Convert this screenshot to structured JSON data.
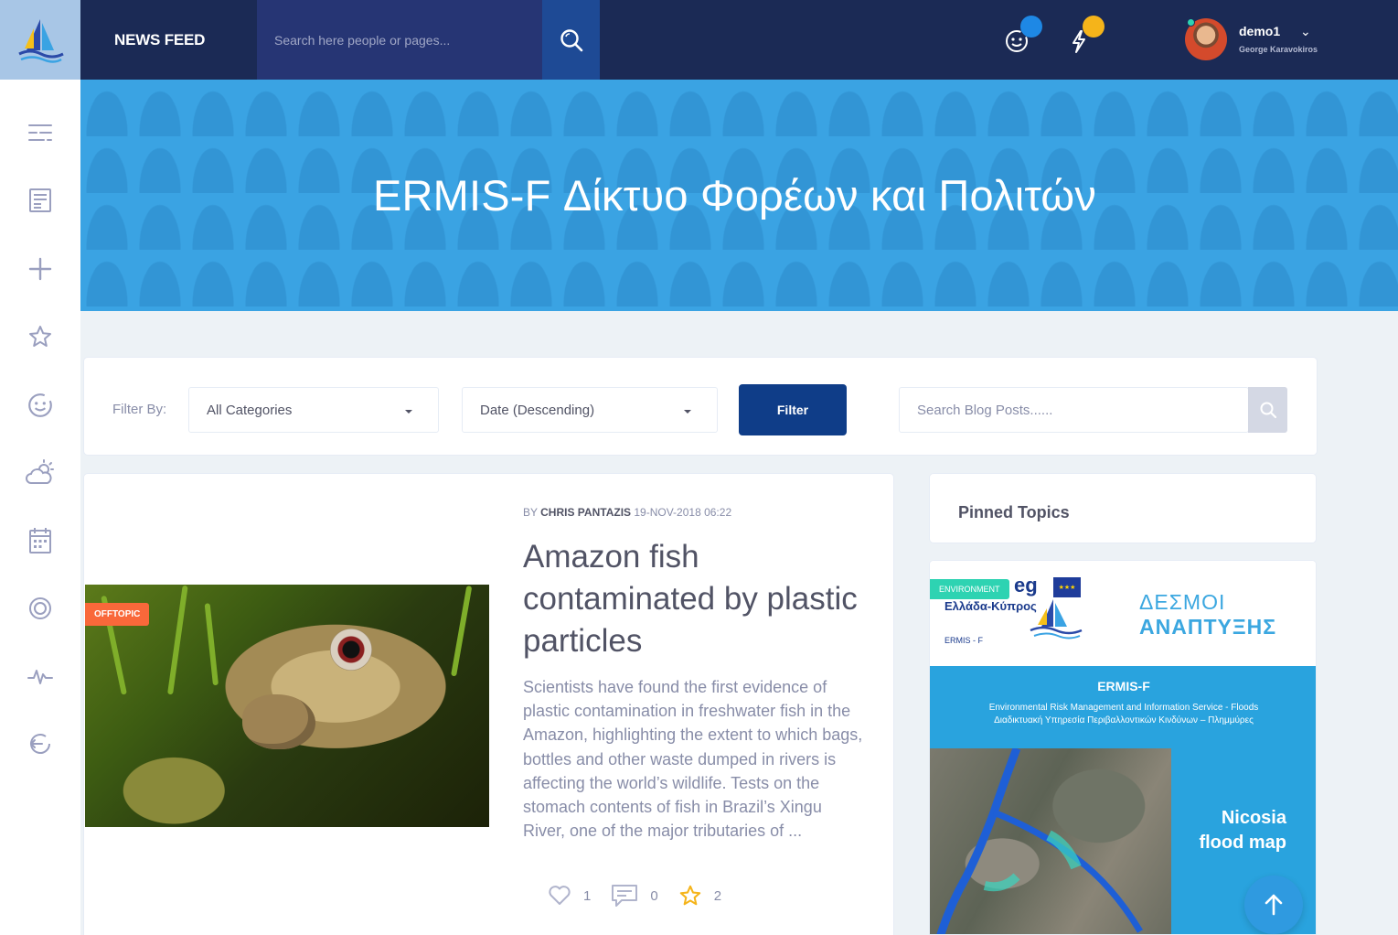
{
  "header": {
    "page_name": "NEWS FEED",
    "search_placeholder": "Search here people or pages...",
    "notifications": [
      {
        "icon": "happy-face-icon",
        "dot_color": "#1e88e5"
      },
      {
        "icon": "thunderbolt-icon",
        "dot_color": "#f5b41a"
      }
    ],
    "user": {
      "name": "demo1",
      "full_name": "George Karavokiros",
      "status_color": "#2ed3b2"
    }
  },
  "sidebar": {
    "items": [
      {
        "icon": "menu-lines-icon"
      },
      {
        "icon": "newsfeed-icon"
      },
      {
        "icon": "plus-icon"
      },
      {
        "icon": "star-icon"
      },
      {
        "icon": "happy-face-icon"
      },
      {
        "icon": "weather-icon"
      },
      {
        "icon": "calendar-icon"
      },
      {
        "icon": "target-icon"
      },
      {
        "icon": "heartbeat-icon"
      },
      {
        "icon": "refresh-icon"
      }
    ]
  },
  "banner": {
    "title": "ERMIS-F Δίκτυο Φορέων και Πολιτών"
  },
  "filters": {
    "label": "Filter By:",
    "category": "All Categories",
    "sort": "Date (Descending)",
    "button": "Filter",
    "search_placeholder": "Search Blog Posts......"
  },
  "post": {
    "category": "OFFTOPIC",
    "by": "BY",
    "author": "CHRIS PANTAZIS",
    "date": "19-NOV-2018 06:22",
    "title": "Amazon fish contaminated by plastic particles",
    "excerpt": "Scientists have found the first evidence of plastic contamination in freshwater fish in the Amazon, highlighting the extent to which bags, bottles and other waste dumped in rivers is affecting the world’s wildlife. Tests on the stomach contents of fish in Brazil’s Xingu River, one of the major tributaries of ...",
    "likes": "1",
    "comments": "0",
    "stars": "2"
  },
  "pinned": {
    "title": "Pinned Topics",
    "card": {
      "category": "ENVIRONMENT",
      "logo_text": "eg",
      "logo_sub": "Ελλάδα-Κύπρος",
      "logo_ermis": "ERMIS - F",
      "headline_line1": "ΔΕΣΜΟΙ",
      "headline_line2": "ΑΝΑΠΤΥΞΗΣ",
      "project": "ERMIS-F",
      "desc_en": "Environmental Risk Management and Information Service - Floods",
      "desc_gr": "Διαδικτυακή Υπηρεσία Περιβαλλοντικών Κινδύνων – Πλημμύρες",
      "map_label": "Nicosia flood map"
    }
  },
  "colors": {
    "topbar": "#1b2a55",
    "accent": "#3aa3e3",
    "filter_button": "#0f3d88",
    "offtopic_badge": "#f9683a",
    "environment_badge": "#2ed3b2"
  }
}
